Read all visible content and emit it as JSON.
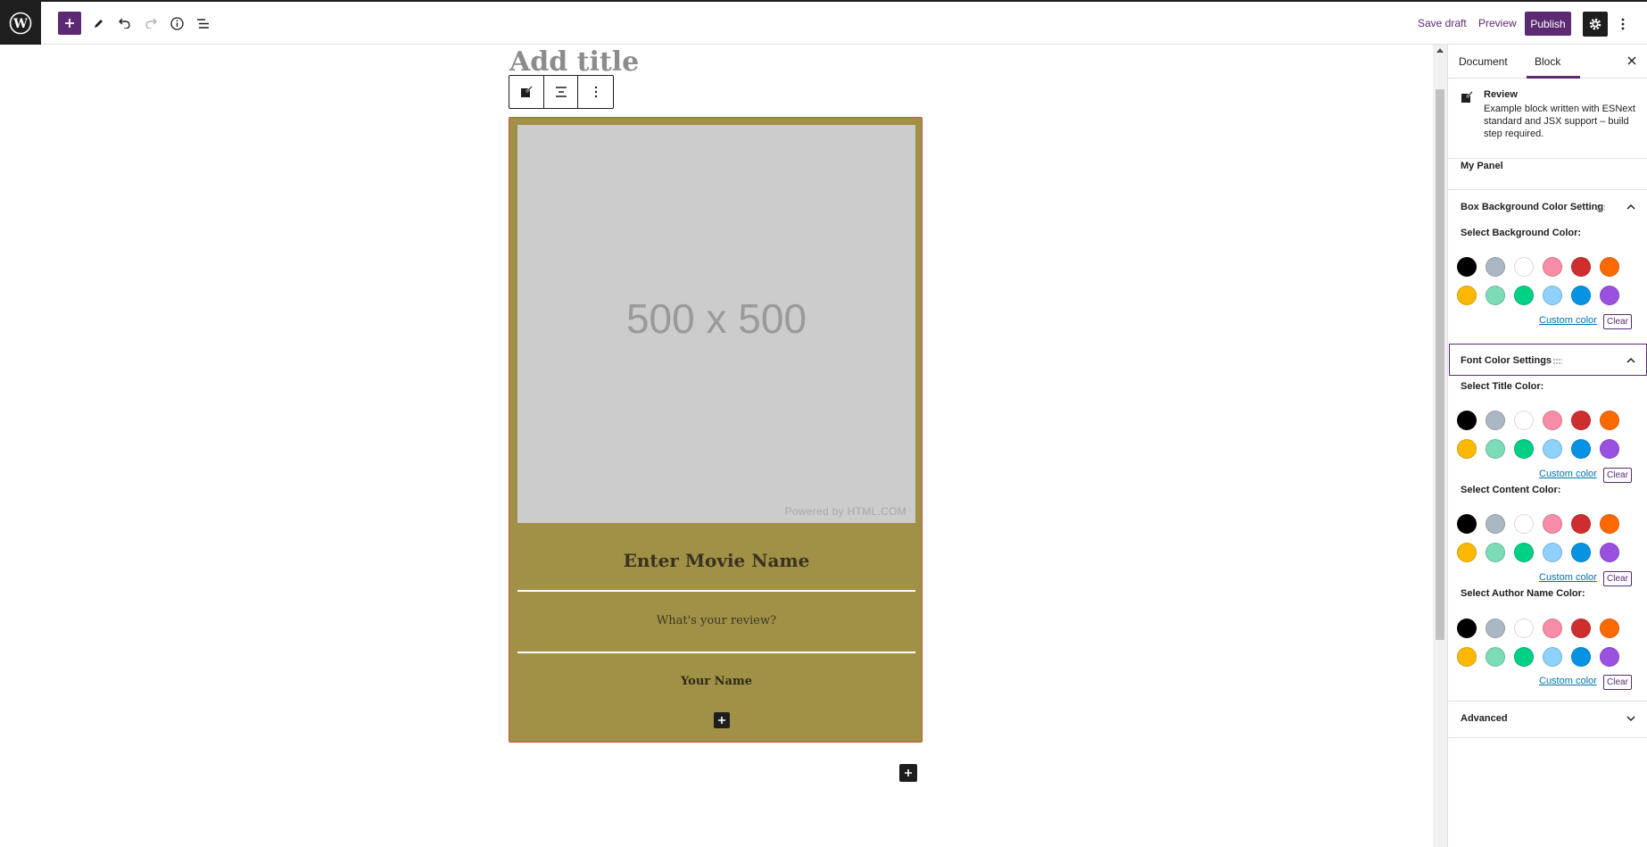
{
  "toolbar": {
    "save_draft": "Save draft",
    "preview": "Preview",
    "publish": "Publish",
    "icons": [
      "wordpress-icon",
      "plus-icon",
      "pencil-icon",
      "undo-icon",
      "redo-icon",
      "info-icon",
      "list-view-icon",
      "gear-icon",
      "more-vertical-icon"
    ]
  },
  "editor": {
    "title_placeholder": "Add title",
    "review_block": {
      "image_text": "500 x 500",
      "image_credit": "Powered by HTML.COM",
      "movie_placeholder": "Enter Movie Name",
      "review_placeholder": "What's your review?",
      "author_placeholder": "Your Name",
      "background_color": "#a09146"
    }
  },
  "sidebar": {
    "tabs": [
      "Document",
      "Block"
    ],
    "active_tab": "Block",
    "block_card": {
      "title": "Review",
      "description": "Example block written with ESNext standard and JSX support – build step required."
    },
    "my_panel": "My Panel",
    "bg_panel": {
      "title": "Box Background Color Setting",
      "label": "Select Background Color:"
    },
    "font_panel": {
      "title": "Font Color Settings",
      "title_label": "Select Title Color:",
      "content_label": "Select Content Color:",
      "author_label": "Select Author Name Color:"
    },
    "custom_color": "Custom color",
    "clear": "Clear",
    "advanced": "Advanced",
    "palette": [
      "#000000",
      "#abb8c3",
      "#ffffff",
      "#f78da7",
      "#cf2e2e",
      "#ff6900",
      "#fcb900",
      "#7bdcb5",
      "#00d084",
      "#8ed1fc",
      "#0693e3",
      "#9b51e0"
    ]
  }
}
